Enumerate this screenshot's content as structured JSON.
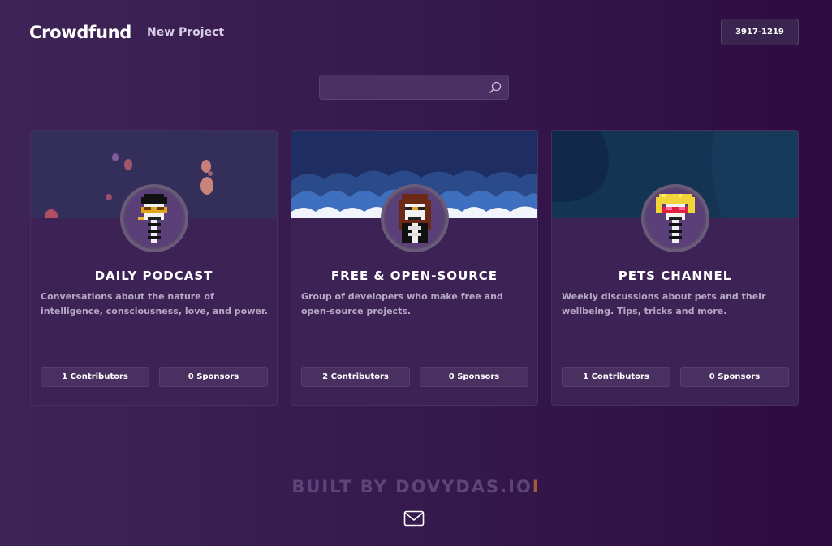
{
  "header": {
    "brand": "Crowdfund",
    "new_project": "New Project",
    "account_id": "3917-1219"
  },
  "search": {
    "placeholder": "",
    "value": ""
  },
  "cards": [
    {
      "title": "DAILY PODCAST",
      "description": "Conversations about the nature of intelligence, consciousness, love, and power.",
      "contributors": "1 Contributors",
      "sponsors": "0 Sponsors"
    },
    {
      "title": "FREE & OPEN-SOURCE",
      "description": "Group of developers who make free and open-source projects.",
      "contributors": "2 Contributors",
      "sponsors": "0 Sponsors"
    },
    {
      "title": "PETS CHANNEL",
      "description": "Weekly discussions about pets and their wellbeing. Tips, tricks and more.",
      "contributors": "1 Contributors",
      "sponsors": "0 Sponsors"
    }
  ],
  "footer": {
    "built_by": "BUILT BY DOVYDAS.IO",
    "cursor": "I"
  },
  "colors": {
    "accent_arrow": "#2f7fe8",
    "background": "#35184c"
  },
  "icons": [
    "search-icon",
    "chevron-left-icon",
    "chevron-right-icon",
    "mail-icon"
  ]
}
